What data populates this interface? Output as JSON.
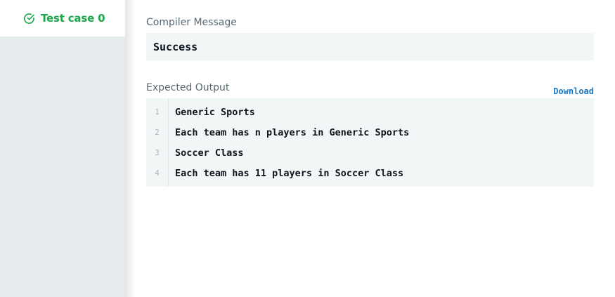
{
  "sidebar": {
    "test_case_label": "Test case 0",
    "test_case_icon": "check-circle-icon",
    "status_color": "#1ba94c"
  },
  "compiler": {
    "label": "Compiler Message",
    "message": "Success"
  },
  "expected_output": {
    "label": "Expected Output",
    "download_label": "Download",
    "lines": [
      {
        "num": "1",
        "text": "Generic Sports"
      },
      {
        "num": "2",
        "text": "Each team has n players in Generic Sports"
      },
      {
        "num": "3",
        "text": "Soccer Class"
      },
      {
        "num": "4",
        "text": "Each team has 11 players in Soccer Class"
      }
    ]
  }
}
